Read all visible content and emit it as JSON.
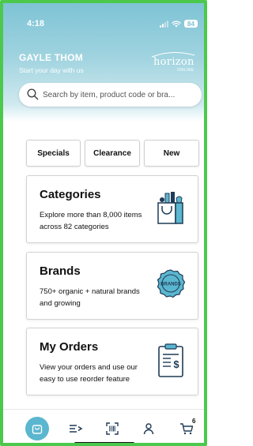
{
  "status_bar": {
    "time": "4:18",
    "battery": "84"
  },
  "header": {
    "user_name": "GAYLE THOM",
    "greeting": "Start your day with us",
    "logo_word": "horizon",
    "logo_sub": "ONLINE"
  },
  "search": {
    "placeholder": "Search by item, product code or bra..."
  },
  "filters": [
    {
      "label": "Specials"
    },
    {
      "label": "Clearance"
    },
    {
      "label": "New"
    }
  ],
  "cards": [
    {
      "title": "Categories",
      "description": "Explore more than 8,000 items across 82 categories",
      "icon": "grocery-bag-icon"
    },
    {
      "title": "Brands",
      "description": "750+ organic + natural brands and growing",
      "icon": "brands-badge-icon",
      "badge_text": "BRANDS"
    },
    {
      "title": "My Orders",
      "description": "View your orders and use our easy to use reorder feature",
      "icon": "invoice-clipboard-icon"
    }
  ],
  "tab_bar": {
    "items": [
      {
        "icon": "shopping-bag-icon",
        "active": true
      },
      {
        "icon": "list-add-icon",
        "active": false
      },
      {
        "icon": "barcode-scan-icon",
        "active": false
      },
      {
        "icon": "account-icon",
        "active": false
      },
      {
        "icon": "cart-icon",
        "active": false
      }
    ],
    "cart_count": "6"
  },
  "colors": {
    "accent": "#5bb6cf",
    "header_gradient_top": "#7ec3d5",
    "frame_border": "#4cc94c",
    "icon_navy": "#1f3b57"
  }
}
